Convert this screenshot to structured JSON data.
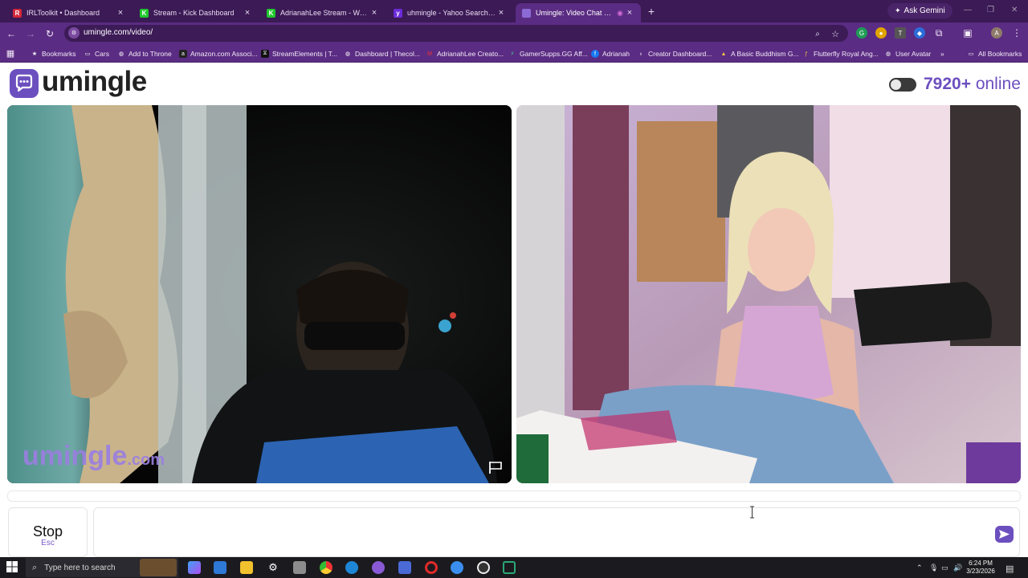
{
  "browser": {
    "tabs": [
      {
        "title": "IRLToolkit • Dashboard",
        "fav": "R",
        "color": "#d3283a"
      },
      {
        "title": "Stream - Kick Dashboard",
        "fav": "K",
        "color": "#21c72d"
      },
      {
        "title": "AdrianahLee Stream - Watch Li",
        "fav": "K",
        "color": "#21c72d"
      },
      {
        "title": "uhmingle - Yahoo Search Resul",
        "fav": "y",
        "color": "#6b2bd9"
      },
      {
        "title": "Umingle: Video Chat with S",
        "fav": "",
        "color": "#8c6ad6"
      }
    ],
    "ask_gemini": "Ask Gemini",
    "url": "umingle.com/video/",
    "bookmarks": [
      "Bookmarks",
      "Cars",
      "Add to Throne",
      "Amazon.com Associ...",
      "StreamElements | T...",
      "Dashboard | Thecol...",
      "AdrianahLee Creato...",
      "GamerSupps.GG Aff...",
      "Adrianah",
      "Creator Dashboard...",
      "A Basic Buddhism G...",
      "Flutterfly Royal Ang...",
      "User Avatar"
    ],
    "all_bookmarks": "All Bookmarks"
  },
  "page": {
    "logo": "umingle",
    "online_count": "7920+",
    "online_label": "online",
    "watermark": "umingle",
    "watermark_domain": ".com",
    "stop_label": "Stop",
    "stop_key": "Esc"
  },
  "taskbar": {
    "search_placeholder": "Type here to search",
    "time": "6:24 PM",
    "date": "3/23/2026"
  }
}
